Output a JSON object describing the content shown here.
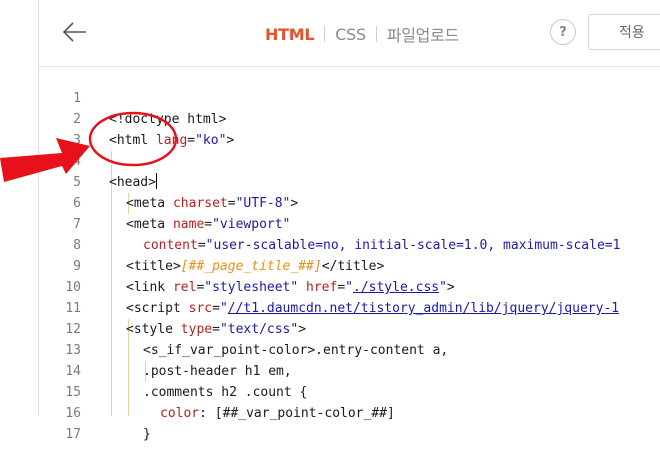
{
  "header": {
    "back_label": "←",
    "tabs": [
      {
        "label": "HTML",
        "active": true
      },
      {
        "label": "CSS",
        "active": false
      },
      {
        "label": "파일업로드",
        "active": false
      }
    ],
    "help_label": "?",
    "apply_label": "적용"
  },
  "editor": {
    "lines": [
      {
        "no": "1"
      },
      {
        "no": "2"
      },
      {
        "no": "3"
      },
      {
        "no": "4"
      },
      {
        "no": "5"
      },
      {
        "no": "6"
      },
      {
        "no": "7"
      },
      {
        "no": "8"
      },
      {
        "no": "9"
      },
      {
        "no": "10"
      },
      {
        "no": "11"
      },
      {
        "no": "12"
      },
      {
        "no": "13"
      },
      {
        "no": "14"
      },
      {
        "no": "15"
      },
      {
        "no": "16"
      },
      {
        "no": "17"
      }
    ],
    "code": {
      "l1": "<!doctype html>",
      "l2_open": "<html ",
      "l2_attr": "lang",
      "l2_val": "\"ko\"",
      "l2_close": ">",
      "l4": "<head>",
      "l5_open": "<meta ",
      "l5_attr": "charset",
      "l5_val": "\"UTF-8\"",
      "l5_close": ">",
      "l6_open": "<meta ",
      "l6_attr": "name",
      "l6_val": "\"viewport\"",
      "l7_attr": "content",
      "l7_val": "\"user-scalable=no, initial-scale=1.0, maximum-scale=1",
      "l8_open": "<title>",
      "l8_tpl": "[##_page_title_##]",
      "l8_close": "</title>",
      "l9_open": "<link ",
      "l9_attr1": "rel",
      "l9_val1": "\"stylesheet\"",
      "l9_attr2": "href",
      "l9_q1": "\"",
      "l9_link": "./style.css",
      "l9_q2": "\"",
      "l9_close": ">",
      "l10_open": "<script ",
      "l10_attr": "src",
      "l10_q": "\"",
      "l10_link": "//t1.daumcdn.net/tistory_admin/lib/jquery/jquery-1",
      "l11_open": "<style ",
      "l11_attr": "type",
      "l11_val": "\"text/css\"",
      "l11_close": ">",
      "l12": "<s_if_var_point-color>.entry-content a,",
      "l13": ".post-header h1 em,",
      "l14": ".comments h2 .count {",
      "l15_prop": "color",
      "l15_rest": ": [##_var_point-color_##]",
      "l16": "}"
    }
  },
  "colors": {
    "accent": "#e5532e",
    "annotation": "#e8101a"
  }
}
